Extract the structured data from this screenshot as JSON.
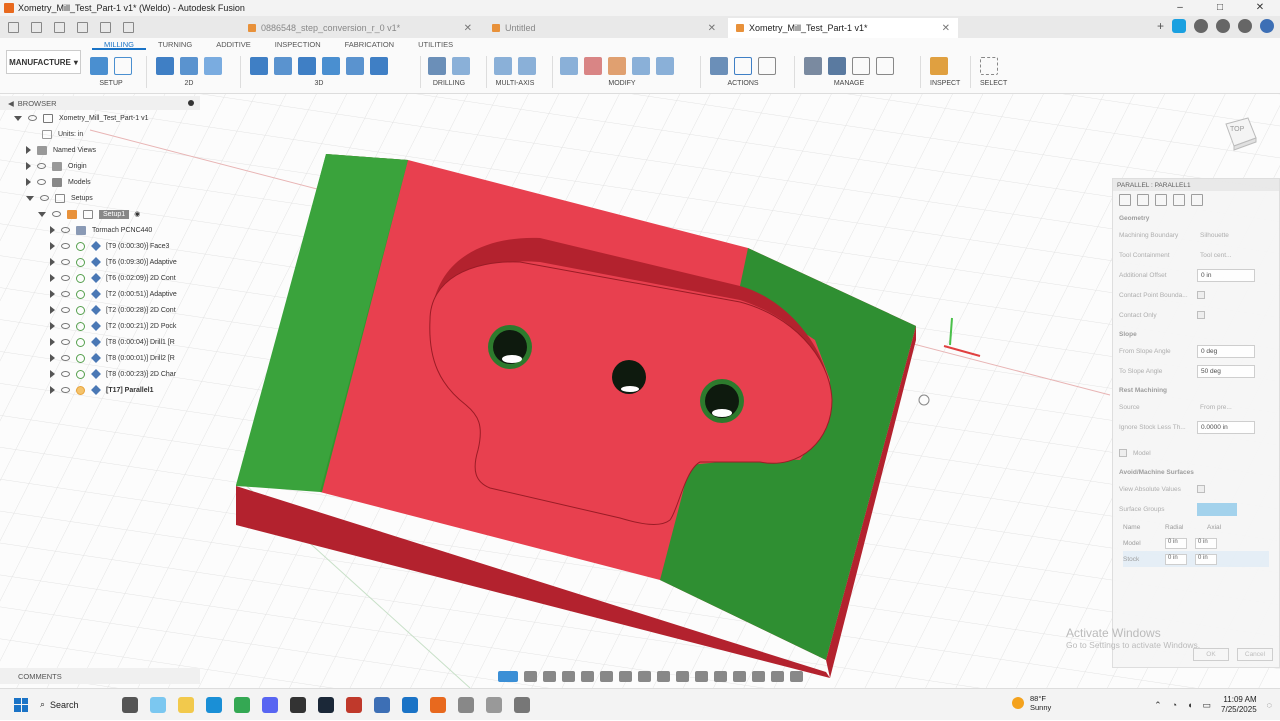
{
  "window": {
    "title": "Xometry_Mill_Test_Part-1 v1* (Weldo) - Autodesk Fusion",
    "controls": [
      "–",
      "□",
      "✕"
    ]
  },
  "tabs": [
    {
      "label": "0886548_step_conversion_r_0 v1*",
      "active": false
    },
    {
      "label": "Untitled",
      "active": false
    },
    {
      "label": "Xometry_Mill_Test_Part-1 v1*",
      "active": true
    }
  ],
  "ribbon": {
    "workspace": "MANUFACTURE",
    "tabs": [
      "MILLING",
      "TURNING",
      "ADDITIVE",
      "INSPECTION",
      "FABRICATION",
      "UTILITIES"
    ],
    "groups": [
      "SETUP",
      "2D",
      "3D",
      "DRILLING",
      "MULTI-AXIS",
      "MODIFY",
      "ACTIONS",
      "MANAGE",
      "INSPECT",
      "SELECT"
    ]
  },
  "browser": {
    "header": "BROWSER",
    "root": "Xometry_Mill_Test_Part-1 v1",
    "units": "Units: in",
    "nodes": [
      "Named Views",
      "Origin",
      "Models",
      "Setups"
    ],
    "setup": "Setup1",
    "machine": "Tormach PCNC440",
    "operations": [
      "[T9 (0:00:30)] Face3",
      "[T6 (0:09:30)] Adaptive",
      "[T6 (0:02:09)] 2D Cont",
      "[T2 (0:00:51)] Adaptive",
      "[T2 (0:00:28)] 2D Cont",
      "[T2 (0:00:21)] 2D Pock",
      "[T8 (0:00:04)] Drill1 [R",
      "[T8 (0:00:01)] Drill2 [R",
      "[T8 (0:00:23)] 2D Char",
      "[T17] Parallel1"
    ]
  },
  "panel": {
    "header": "PARALLEL : PARALLEL1",
    "geometry_title": "Geometry",
    "machining_boundary": {
      "label": "Machining Boundary",
      "value": "Silhouette"
    },
    "tool_containment": {
      "label": "Tool Containment",
      "value": "Tool cent..."
    },
    "additional_offset": {
      "label": "Additional Offset",
      "value": "0 in"
    },
    "contact_point_boundary": "Contact Point Bounda...",
    "contact_only": "Contact Only",
    "slope_title": "Slope",
    "from_slope_angle": {
      "label": "From Slope Angle",
      "value": "0 deg"
    },
    "to_slope_angle": {
      "label": "To Slope Angle",
      "value": "50 deg"
    },
    "rest_title": "Rest Machining",
    "source": {
      "label": "Source",
      "value": "From pre..."
    },
    "ignore_stock": {
      "label": "Ignore Stock Less Th...",
      "value": "0.0000 in"
    },
    "model_label": "Model",
    "avoid_title": "Avoid/Machine Surfaces",
    "view_absolute": "View Absolute Values",
    "surface_groups": "Surface Groups",
    "table_headers": [
      "Name",
      "Radial",
      "Axial"
    ],
    "rows": [
      {
        "name": "Model",
        "radial": "0 in",
        "axial": "0 in"
      },
      {
        "name": "Stock",
        "radial": "0 in",
        "axial": "0 in"
      }
    ],
    "ok": "OK",
    "cancel": "Cancel"
  },
  "viewcube": "TOP",
  "watermark": {
    "line1": "Activate Windows",
    "line2": "Go to Settings to activate Windows."
  },
  "comments": "COMMENTS",
  "taskbar": {
    "search": "Search",
    "weather_temp": "88°F",
    "weather_cond": "Sunny",
    "time": "11:09 AM",
    "date": "7/25/2025"
  },
  "colors": {
    "green": "#2f8f32",
    "red": "#e8404f",
    "dark_red": "#b3222e",
    "accent": "#1a73c6"
  }
}
